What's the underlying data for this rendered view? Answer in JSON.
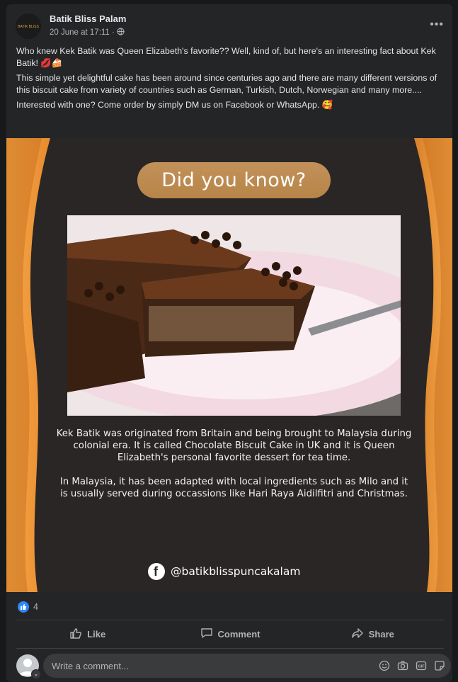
{
  "post": {
    "page_name": "Batik Bliss Palam",
    "avatar_text": "BATIK BLISS",
    "timestamp": "20 June at 17:11 ·",
    "privacy_icon": "globe-icon",
    "more_label": "•••",
    "caption": {
      "line1": "Who knew Kek Batik was Queen Elizabeth's favorite?? Well, kind of, but here's an interesting fact about Kek Batik! 💋🍰",
      "line2": "This simple yet delightful cake has been around since centuries ago and there are many different versions of this biscuit cake from variety of countries such as German, Turkish, Dutch, Norwegian and many more....",
      "line3": "Interested with one? Come order by simply DM us on Facebook or WhatsApp. 🥰"
    }
  },
  "media": {
    "badge": "Did you know?",
    "para1": "Kek Batik was originated from Britain and being brought to Malaysia during colonial era. It is called Chocolate Biscuit Cake in UK and it is Queen Elizabeth's personal favorite dessert for tea time.",
    "para2": "In Malaysia, it has been adapted with local ingredients such as Milo and it is usually served during occassions like Hari Raya Aidilfitri and Christmas.",
    "handle": "@batikblisspuncakalam",
    "colors": {
      "accent_gold": "#c2915a",
      "frame_orange": "#e8953a",
      "background": "#2a2625"
    }
  },
  "reactions": {
    "icon": "thumbs-up-icon",
    "count": "4"
  },
  "actions": {
    "like": "Like",
    "comment": "Comment",
    "share": "Share"
  },
  "composer": {
    "placeholder": "Write a comment...",
    "icons": [
      "emoji-icon",
      "camera-icon",
      "gif-icon",
      "sticker-icon"
    ]
  },
  "colors": {
    "facebook_blue": "#2d88ff",
    "card_bg": "#242526"
  }
}
